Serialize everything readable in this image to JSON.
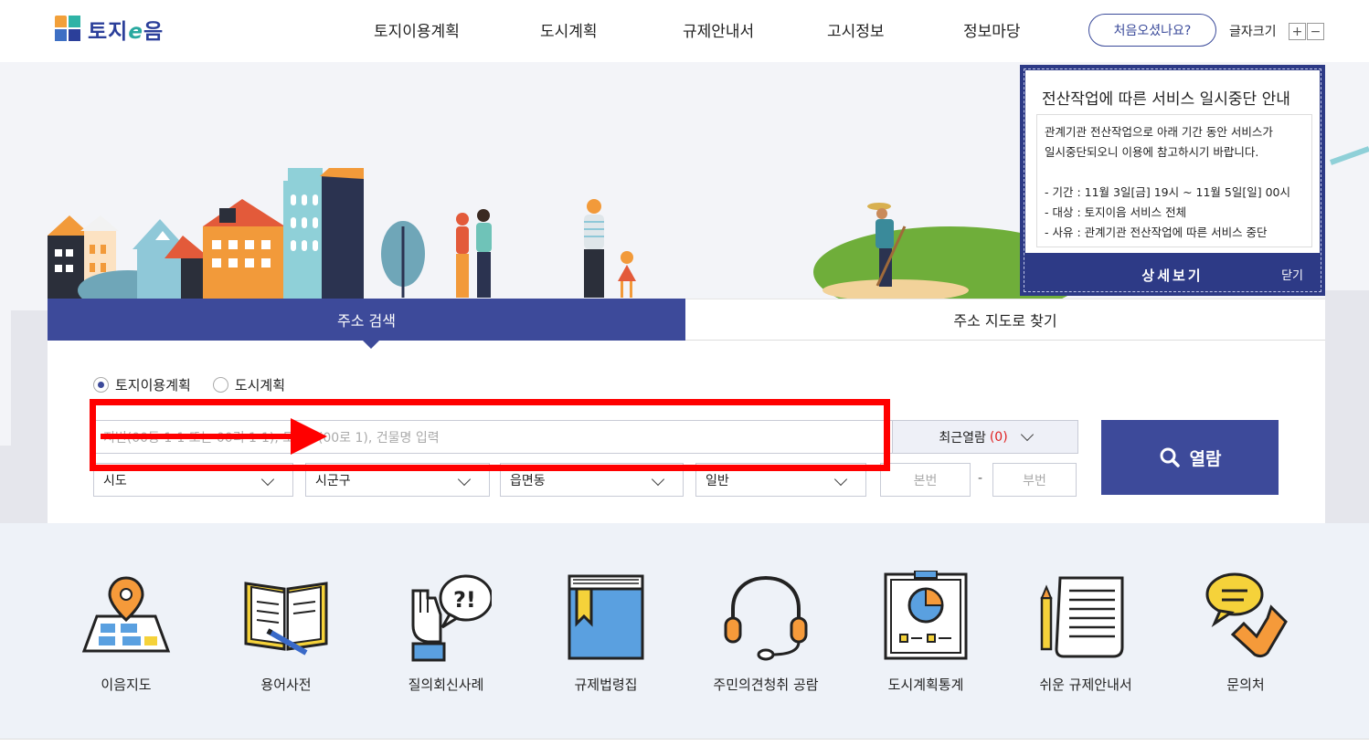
{
  "header": {
    "logo_text": "토지",
    "logo_e": "e",
    "logo_text2": "음",
    "nav": [
      "토지이용계획",
      "도시계획",
      "규제안내서",
      "고시정보",
      "정보마당"
    ],
    "first_visit": "처음오셨나요?",
    "font_size_label": "글자크기",
    "font_plus": "+",
    "font_minus": "−"
  },
  "notice": {
    "title": "전산작업에 따른 서비스 일시중단 안내",
    "line1": "관계기관 전산작업으로 아래 기간 동안 서비스가",
    "line2": "일시중단되오니 이용에 참고하시기 바랍니다.",
    "period": "- 기간 : 11월 3일[금] 19시 ~ 11월 5일[일] 00시",
    "target": "- 대상 : 토지이음 서비스 전체",
    "reason": "- 사유 : 관계기관 전산작업에 따른 서비스 중단",
    "detail_button": "상세보기",
    "close_button": "닫기"
  },
  "search": {
    "tab_active": "주소 검색",
    "tab_inactive": "주소 지도로 찾기",
    "radio_options": [
      "토지이용계획",
      "도시계획"
    ],
    "selected_radio": "토지이용계획",
    "input_placeholder": "지번(00동 1-1 또는 00리 1-1), 도로명(00로 1), 건물명 입력",
    "recent_label": "최근열람",
    "recent_count": "(0)",
    "selects": [
      "시도",
      "시군구",
      "읍면동",
      "일반"
    ],
    "main_no_placeholder": "본번",
    "sub_no_placeholder": "부번",
    "dash": "-",
    "go_button": "열람"
  },
  "quick_menu": [
    {
      "label": "이음지도",
      "icon": "map-pin-icon"
    },
    {
      "label": "용어사전",
      "icon": "open-book-icon"
    },
    {
      "label": "질의회신사례",
      "icon": "hand-question-icon"
    },
    {
      "label": "규제법령집",
      "icon": "law-book-icon"
    },
    {
      "label": "주민의견청취 공람",
      "icon": "headset-icon"
    },
    {
      "label": "도시계획통계",
      "icon": "pie-chart-board-icon"
    },
    {
      "label": "쉬운 규제안내서",
      "icon": "document-pencil-icon"
    },
    {
      "label": "문의처",
      "icon": "phone-chat-icon"
    }
  ],
  "colors": {
    "brand": "#3d4a9a",
    "notice_bg": "#2d3a86",
    "highlight": "#ff0000",
    "accent_orange": "#f5a03a"
  }
}
